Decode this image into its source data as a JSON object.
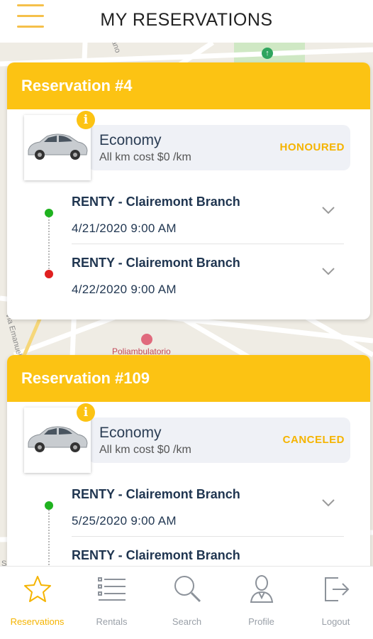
{
  "header": {
    "title": "MY RESERVATIONS"
  },
  "map": {
    "labels": [
      "Poliambulatorio",
      "Via Emanuel",
      "tano",
      "San"
    ],
    "colors": {
      "land": "#efece4",
      "park": "#cfe8c4",
      "road": "#ffffff"
    }
  },
  "reservations": [
    {
      "title": "Reservation #4",
      "car_class": "Economy",
      "cost": "All km cost $0 /km",
      "status": "HONOURED",
      "legs": [
        {
          "branch": "RENTY - Clairemont Branch",
          "datetime": "4/21/2020 9:00 AM",
          "dot": "green"
        },
        {
          "branch": "RENTY - Clairemont Branch",
          "datetime": "4/22/2020 9:00 AM",
          "dot": "red"
        }
      ]
    },
    {
      "title": "Reservation #109",
      "car_class": "Economy",
      "cost": "All km cost $0 /km",
      "status": "CANCELED",
      "legs": [
        {
          "branch": "RENTY - Clairemont Branch",
          "datetime": "5/25/2020 9:00 AM",
          "dot": "green"
        },
        {
          "branch": "RENTY - Clairemont Branch",
          "datetime": "",
          "dot": "red"
        }
      ]
    }
  ],
  "tabs": [
    {
      "label": "Reservations",
      "icon": "star-icon",
      "active": true
    },
    {
      "label": "Rentals",
      "icon": "list-icon",
      "active": false
    },
    {
      "label": "Search",
      "icon": "search-icon",
      "active": false
    },
    {
      "label": "Profile",
      "icon": "person-icon",
      "active": false
    },
    {
      "label": "Logout",
      "icon": "logout-icon",
      "active": false
    }
  ],
  "colors": {
    "accent": "#fcc313",
    "status_text": "#f5b400",
    "primary_text": "#1f3550",
    "inactive_tab": "#9aa0a8"
  }
}
